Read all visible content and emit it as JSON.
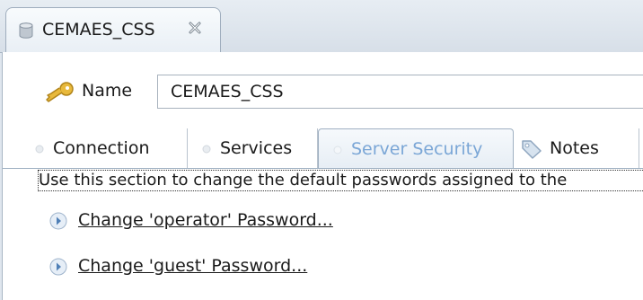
{
  "editor_tab": {
    "title": "CEMAES_CSS",
    "icon": "database-icon",
    "close_icon": "close-icon"
  },
  "name_field": {
    "label": "Name",
    "value": "CEMAES_CSS",
    "icon": "key-icon"
  },
  "section_tabs": [
    {
      "label": "Connection",
      "selected": false
    },
    {
      "label": "Services",
      "selected": false
    },
    {
      "label": "Server Security",
      "selected": true
    },
    {
      "label": "Notes",
      "selected": false,
      "icon": "tag-icon"
    }
  ],
  "server_security": {
    "description": "Use this section to change the default passwords assigned to the",
    "links": [
      {
        "label": "Change 'operator' Password..."
      },
      {
        "label": "Change 'guest' Password..."
      }
    ]
  },
  "colors": {
    "selected_tab_text": "#7aa6d6",
    "chevron": "#4f7fb6"
  }
}
